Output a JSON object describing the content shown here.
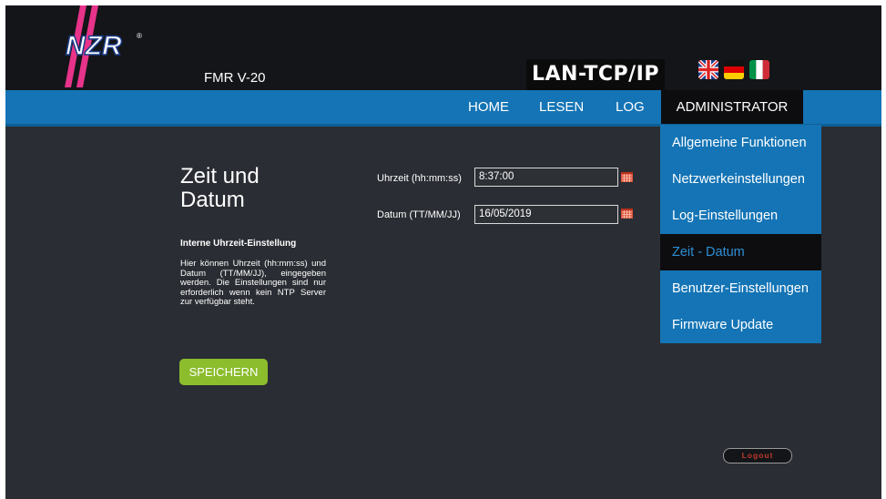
{
  "header": {
    "logo_text": "NZR",
    "model": "FMR V-20",
    "protocol": "LAN-TCP/IP",
    "languages": [
      "english-flag-icon",
      "german-flag-icon",
      "italian-flag-icon"
    ]
  },
  "nav": {
    "home": "HOME",
    "lesen": "LESEN",
    "log": "LOG",
    "admin": "ADMINISTRATOR"
  },
  "admin_menu": {
    "items": [
      {
        "label": "Allgemeine Funktionen"
      },
      {
        "label": "Netzwerkeinstellungen"
      },
      {
        "label": "Log-Einstellungen"
      },
      {
        "label": "Zeit - Datum",
        "active": true
      },
      {
        "label": "Benutzer-Einstellungen"
      },
      {
        "label": "Firmware Update"
      }
    ]
  },
  "page": {
    "title_line1": "Zeit und",
    "title_line2": "Datum",
    "subtitle": "Interne Uhrzeit-Einstellung",
    "description": "Hier können Uhrzeit (hh:mm:ss) und Datum (TT/MM/JJ), eingegeben werden. Die Einstellungen sind nur erforderlich wenn kein NTP Server zur verfügbar steht.",
    "save_label": "SPEICHERN"
  },
  "form": {
    "time_label": "Uhrzeit (hh:mm:ss)",
    "time_value": "8:37:00",
    "date_label": "Datum (TT/MM/JJ)",
    "date_value": "16/05/2019"
  },
  "footer": {
    "logout_label": "Logout"
  },
  "colors": {
    "nav_blue": "#1474b5",
    "save_green": "#8cbd2d",
    "background": "#2a2d33",
    "active_text": "#2e8fd6",
    "logout_red": "#c0392b"
  }
}
